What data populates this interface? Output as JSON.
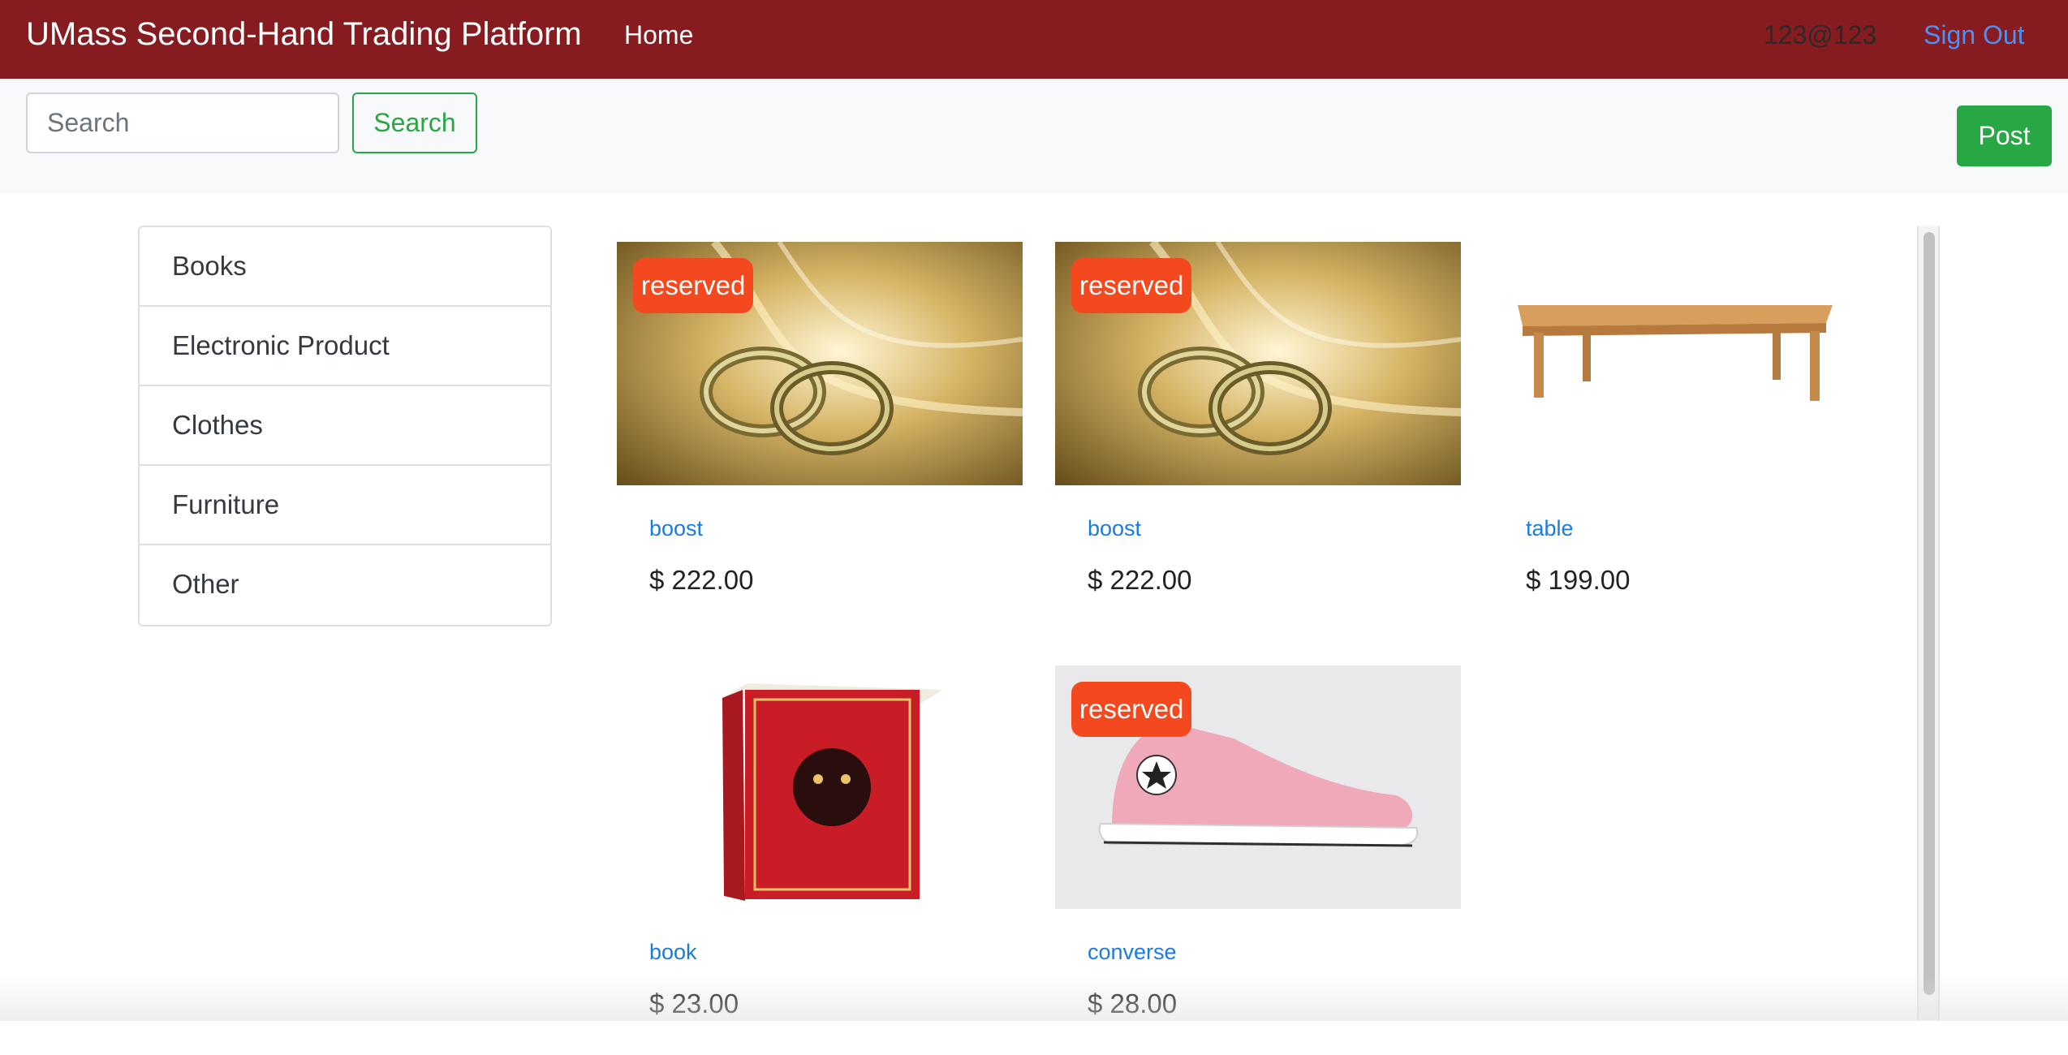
{
  "navbar": {
    "brand": "UMass Second-Hand Trading Platform",
    "home": "Home",
    "user": "123@123",
    "sign_out": "Sign Out"
  },
  "toolbar": {
    "search_placeholder": "Search",
    "search_button": "Search",
    "post_button": "Post"
  },
  "categories": [
    "Books",
    "Electronic Product",
    "Clothes",
    "Furniture",
    "Other"
  ],
  "products": [
    {
      "title": "boost",
      "price": "$ 222.00",
      "badge": "reserved",
      "image": "gold-rings"
    },
    {
      "title": "boost",
      "price": "$ 222.00",
      "badge": "reserved",
      "image": "gold-rings"
    },
    {
      "title": "table",
      "price": "$ 199.00",
      "badge": "",
      "image": "wooden-table"
    },
    {
      "title": "book",
      "price": "$ 23.00",
      "badge": "",
      "image": "red-book"
    },
    {
      "title": "converse",
      "price": "$ 28.00",
      "badge": "reserved",
      "image": "pink-sneaker"
    }
  ],
  "colors": {
    "navbar_bg": "#861c20",
    "success": "#28a745",
    "badge": "#f4491f",
    "link": "#1a7be0"
  }
}
